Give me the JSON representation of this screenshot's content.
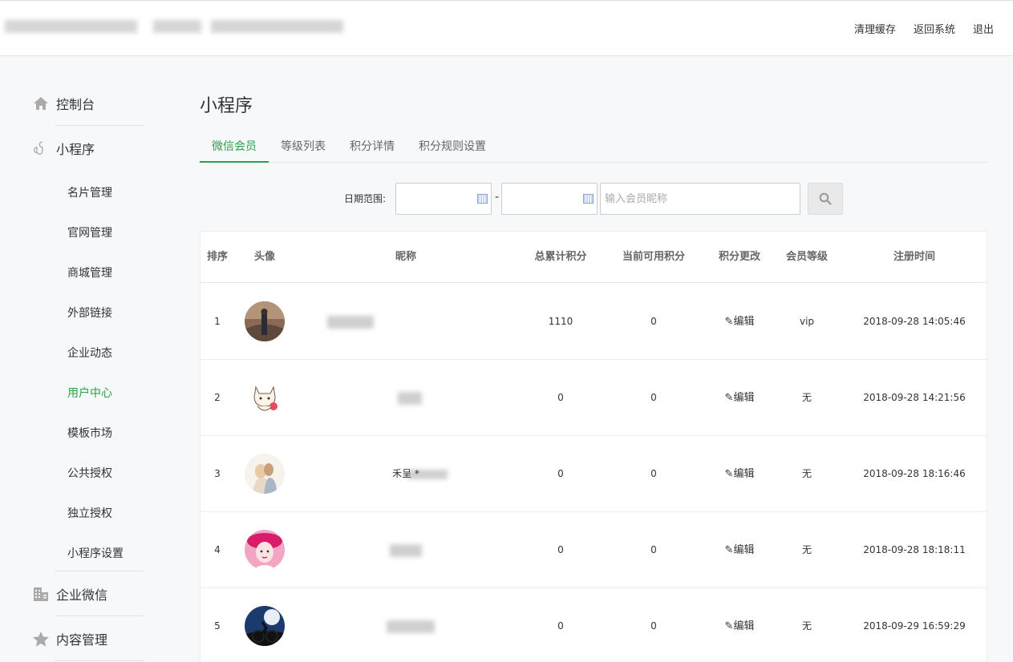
{
  "top_links": [
    "清理缓存",
    "返回系统",
    "退出"
  ],
  "sidebar": {
    "groups": [
      {
        "label": "控制台",
        "icon": "home-icon"
      },
      {
        "label": "小程序",
        "icon": "miniprogram-icon"
      },
      {
        "label": "企业微信",
        "icon": "building-icon"
      },
      {
        "label": "内容管理",
        "icon": "star-icon"
      }
    ],
    "sub_items": [
      "名片管理",
      "官网管理",
      "商城管理",
      "外部链接",
      "企业动态",
      "用户中心",
      "模板市场",
      "公共授权",
      "独立授权",
      "小程序设置"
    ],
    "active_sub": "用户中心"
  },
  "page_title": "小程序",
  "tabs": [
    "微信会员",
    "等级列表",
    "积分详情",
    "积分规则设置"
  ],
  "filter": {
    "date_label": "日期范围:",
    "separator": "-",
    "search_placeholder": "输入会员昵称"
  },
  "table": {
    "headers": [
      "排序",
      "头像",
      "昵称",
      "总累计积分",
      "当前可用积分",
      "积分更改",
      "会员等级",
      "注册时间"
    ],
    "rows": [
      {
        "rank": "1",
        "nickname": "",
        "total": "1110",
        "available": "0",
        "edit": "编辑",
        "level": "vip",
        "registered": "2018-09-28 14:05:46"
      },
      {
        "rank": "2",
        "nickname": "",
        "total": "0",
        "available": "0",
        "edit": "编辑",
        "level": "无",
        "registered": "2018-09-28 14:21:56"
      },
      {
        "rank": "3",
        "nickname": "禾呈 *",
        "total": "0",
        "available": "0",
        "edit": "编辑",
        "level": "无",
        "registered": "2018-09-28 18:16:46"
      },
      {
        "rank": "4",
        "nickname": "",
        "total": "0",
        "available": "0",
        "edit": "编辑",
        "level": "无",
        "registered": "2018-09-28 18:18:11"
      },
      {
        "rank": "5",
        "nickname": "",
        "total": "0",
        "available": "0",
        "edit": "编辑",
        "level": "无",
        "registered": "2018-09-29 16:59:29"
      }
    ]
  },
  "colors": {
    "accent": "#2aa148",
    "background": "#f7f8fa"
  }
}
